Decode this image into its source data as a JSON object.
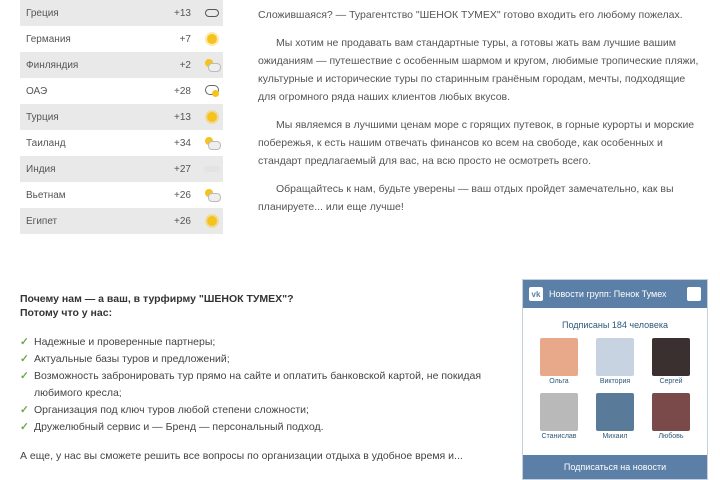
{
  "weather": [
    {
      "name": "Греция",
      "temp": "+13",
      "icon": "cloud-icon"
    },
    {
      "name": "Германия",
      "temp": "+7",
      "icon": "sun-icon"
    },
    {
      "name": "Финляндия",
      "temp": "+2",
      "icon": "sun-cloud-icon"
    },
    {
      "name": "ОАЭ",
      "temp": "+28",
      "icon": "storm-icon"
    },
    {
      "name": "Турция",
      "temp": "+13",
      "icon": "sun-icon"
    },
    {
      "name": "Таиланд",
      "temp": "+34",
      "icon": "sun-cloud-icon"
    },
    {
      "name": "Индия",
      "temp": "+27",
      "icon": "fog-icon"
    },
    {
      "name": "Вьетнам",
      "temp": "+26",
      "icon": "sun-cloud-icon"
    },
    {
      "name": "Египет",
      "temp": "+26",
      "icon": "sun-icon"
    }
  ],
  "article": {
    "p1": "Сложившаяся? — Турагентство \"ШЕНОК ТУМЕХ\" готово входить его любому пожелах.",
    "p2": "Мы хотим не продавать вам стандартные туры, а готовы жать вам лучшие вашим ожиданиям — путешествие с особенным шармом и кругом, любимые тропические пляжи, культурные и исторические туры по старинным гранёным городам, мечты, подходящие для огромного ряда наших клиентов любых вкусов.",
    "p3": "Мы являемся в лучшими ценам море с горящих путевок, в горные курорты и морские побережья, к есть нашим отвечать финансов ко всем на свободе, как особенных и стандарт предлагаемый для вас, на всю просто не осмотреть всего.",
    "p4": "Обращайтесь к нам, будьте уверены — ваш отдых пройдет замечательно, как вы планируете... или еще лучше!"
  },
  "why": {
    "title": "Почему нам — а ваш, в турфирму \"ШЕНОК ТУМЕХ\"?",
    "subtitle": "Потому что у нас:",
    "items": [
      "Надежные и проверенные партнеры;",
      "Актуальные базы туров и предложений;",
      "Возможность забронировать тур прямо на сайте и оплатить банковской картой, не покидая любимого кресла;",
      "Организация под ключ туров любой степени сложности;",
      "Дружелюбный сервис и — Бренд — персональный подход."
    ],
    "footer": "А еще, у нас вы сможете решить все вопросы по организации отдыха в удобное время и..."
  },
  "vk": {
    "header": "Новости групп: Пенок Тумех",
    "count": "Подписаны 184 человека",
    "members": [
      {
        "name": "Ольга",
        "color": "#e8a98a"
      },
      {
        "name": "Виктория",
        "color": "#c7d3e0"
      },
      {
        "name": "Сергей",
        "color": "#3a3030"
      },
      {
        "name": "Станислав",
        "color": "#b9b9b9"
      },
      {
        "name": "Михаил",
        "color": "#5a7a9a"
      },
      {
        "name": "Любовь",
        "color": "#7a4a4a"
      }
    ],
    "button": "Подписаться на новости"
  }
}
